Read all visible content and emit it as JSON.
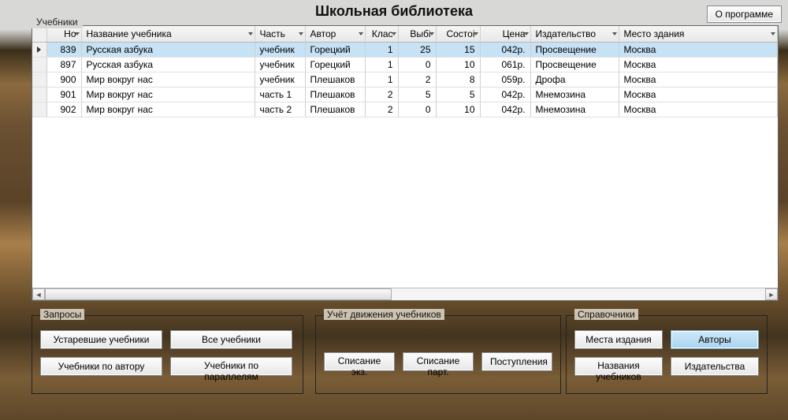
{
  "app_title": "Школьная библиотека",
  "about_label": "О программе",
  "tabs_label": "Учебники",
  "columns": {
    "num": "Но",
    "name": "Название учебника",
    "part": "Часть",
    "author": "Автор",
    "class": "Клас",
    "out": "Выбі",
    "cond": "Состоі",
    "price": "Цена",
    "pub": "Издательство",
    "place": "Место здания"
  },
  "rows": [
    {
      "num": "839",
      "name": "Русская азбука",
      "part": "учебник",
      "author": "Горецкий",
      "class": "1",
      "out": "25",
      "cond": "15",
      "price": "042р.",
      "pub": "Просвещение",
      "place": "Москва",
      "selected": true
    },
    {
      "num": "897",
      "name": "Русская азбука",
      "part": "учебник",
      "author": "Горецкий",
      "class": "1",
      "out": "0",
      "cond": "10",
      "price": "061р.",
      "pub": "Просвещение",
      "place": "Москва"
    },
    {
      "num": "900",
      "name": "Мир вокруг нас",
      "part": "учебник",
      "author": "Плешаков",
      "class": "1",
      "out": "2",
      "cond": "8",
      "price": "059р.",
      "pub": "Дрофа",
      "place": "Москва"
    },
    {
      "num": "901",
      "name": "Мир вокруг нас",
      "part": "часть 1",
      "author": "Плешаков",
      "class": "2",
      "out": "5",
      "cond": "5",
      "price": "042р.",
      "pub": "Мнемозина",
      "place": "Москва"
    },
    {
      "num": "902",
      "name": "Мир вокруг нас",
      "part": "часть 2",
      "author": "Плешаков",
      "class": "2",
      "out": "0",
      "cond": "10",
      "price": "042р.",
      "pub": "Мнемозина",
      "place": "Москва"
    }
  ],
  "groups": {
    "queries": {
      "title": "Запросы",
      "outdated": "Устаревшие учебники",
      "all": "Все учебники",
      "by_author": "Учебники по автору",
      "by_parallel": "Учебники по параллелям"
    },
    "movement": {
      "title": "Учёт движения учебников",
      "writeoff_ex": "Списание экз.",
      "writeoff_batch": "Списание парт.",
      "income": "Поступления"
    },
    "refs": {
      "title": "Справочники",
      "places": "Места издания",
      "authors": "Авторы",
      "names": "Названия учебников",
      "publishers": "Издательства"
    }
  }
}
